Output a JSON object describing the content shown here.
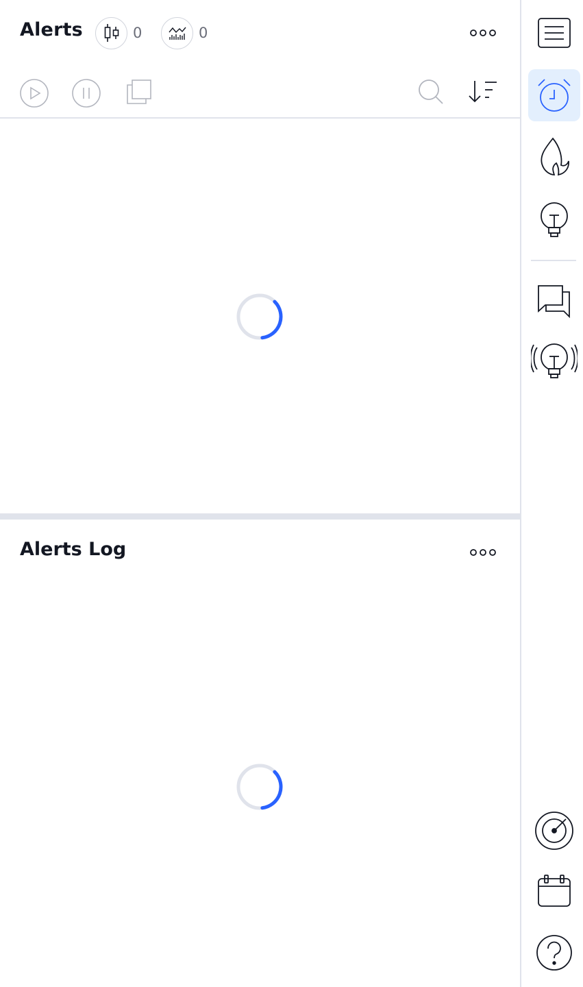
{
  "alerts": {
    "title": "Alerts",
    "price_alerts_count": "0",
    "indicator_alerts_count": "0"
  },
  "log": {
    "title": "Alerts Log"
  },
  "toolbar": {
    "icons": [
      "play-icon",
      "pause-icon",
      "copy-icon",
      "search-icon",
      "sort-icon"
    ]
  },
  "rail": {
    "icons": [
      "menu-icon",
      "alarm-clock-icon",
      "flame-icon",
      "lightbulb-icon",
      "chat-icon",
      "broadcast-lightbulb-icon",
      "radar-icon",
      "calendar-icon",
      "help-icon"
    ],
    "active": "alarm-clock-icon"
  },
  "colors": {
    "accent": "#2962ff",
    "active_bg": "#e3effd",
    "text": "#131722",
    "muted": "#6a6d78",
    "border": "#e0e3eb"
  }
}
